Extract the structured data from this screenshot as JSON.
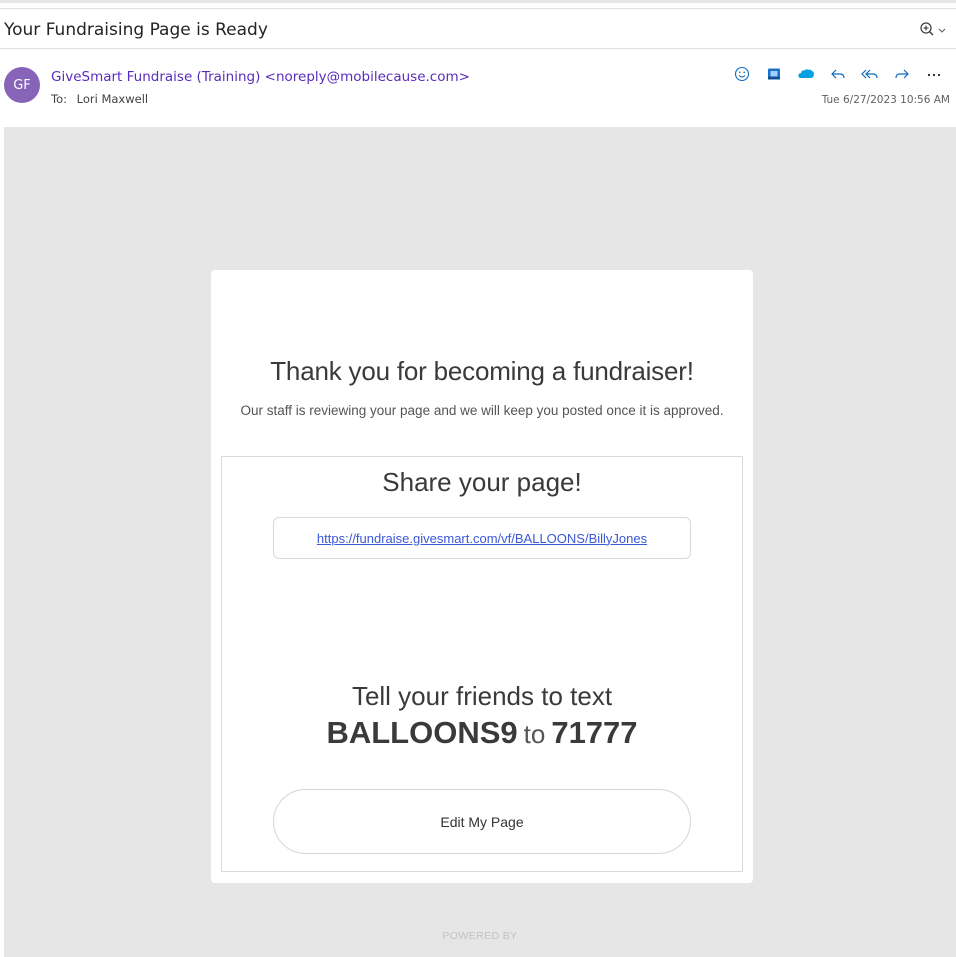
{
  "email": {
    "subject": "Your Fundraising Page is Ready",
    "avatar_initials": "GF",
    "sender": "GiveSmart Fundraise (Training) <noreply@mobilecause.com>",
    "to_label": "To:",
    "to_name": "Lori Maxwell",
    "timestamp": "Tue 6/27/2023 10:56 AM",
    "accent_color": "#8764b8"
  },
  "toolbar": {
    "icons": [
      "zoom-icon",
      "emoji-icon",
      "outlook-app-icon",
      "salesforce-icon",
      "reply-icon",
      "reply-all-icon",
      "forward-icon",
      "more-icon"
    ]
  },
  "body": {
    "thanks_heading": "Thank you for becoming a fundraiser!",
    "review_text": "Our staff is reviewing your page and we will keep you posted once it is approved.",
    "share_heading": "Share your page!",
    "page_url": "https://fundraise.givesmart.com/vf/BALLOONS/BillyJones",
    "tell_text": "Tell your friends to text",
    "keyword": "BALLOONS9",
    "to_word": "to",
    "shortcode": "71777",
    "edit_button": "Edit My Page",
    "powered_by": "POWERED BY"
  }
}
